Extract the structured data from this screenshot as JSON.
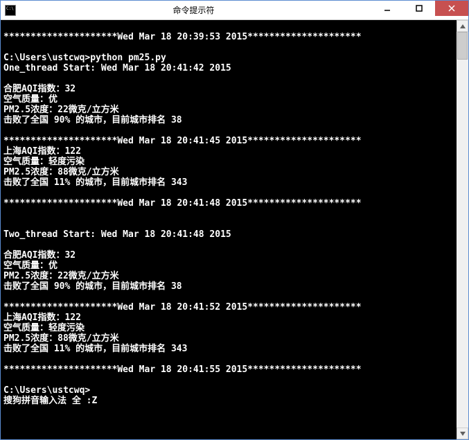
{
  "window": {
    "title": "命令提示符"
  },
  "terminal": {
    "lines": [
      "",
      "*********************Wed Mar 18 20:39:53 2015*********************",
      "",
      "C:\\Users\\ustcwq>python pm25.py",
      "One_thread Start: Wed Mar 18 20:41:42 2015",
      "",
      "合肥AQI指数：32",
      "空气质量：优",
      "PM2.5浓度：22微克/立方米",
      "击败了全国 90% 的城市，目前城市排名 38",
      "",
      "*********************Wed Mar 18 20:41:45 2015*********************",
      "上海AQI指数：122",
      "空气质量：轻度污染",
      "PM2.5浓度：88微克/立方米",
      "击败了全国 11% 的城市，目前城市排名 343",
      "",
      "*********************Wed Mar 18 20:41:48 2015*********************",
      "",
      "",
      "Two_thread Start: Wed Mar 18 20:41:48 2015",
      "",
      "合肥AQI指数：32",
      "空气质量：优",
      "PM2.5浓度：22微克/立方米",
      "击败了全国 90% 的城市，目前城市排名 38",
      "",
      "*********************Wed Mar 18 20:41:52 2015*********************",
      "上海AQI指数：122",
      "空气质量：轻度污染",
      "PM2.5浓度：88微克/立方米",
      "击败了全国 11% 的城市，目前城市排名 343",
      "",
      "*********************Wed Mar 18 20:41:55 2015*********************",
      "",
      "C:\\Users\\ustcwq>",
      "搜狗拼音输入法 全 :Z"
    ]
  }
}
